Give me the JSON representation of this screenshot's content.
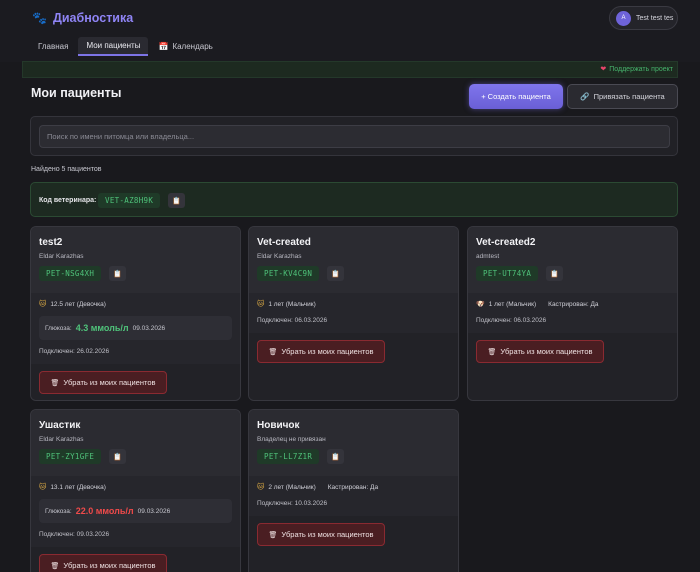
{
  "app": {
    "title": "Диабностика",
    "logo_icon": "paw-icon"
  },
  "user": {
    "avatar_letter": "A",
    "name": "Test test tes"
  },
  "nav": {
    "tabs": [
      {
        "label": "Главная"
      },
      {
        "label": "Мои пациенты"
      },
      {
        "label": "Календарь"
      }
    ]
  },
  "support": {
    "label": "Поддержать проект"
  },
  "page": {
    "title": "Мои пациенты",
    "create_button": "+ Создать пациента",
    "link_button": "Привязать пациента",
    "search_placeholder": "Поиск по имени питомца или владельца...",
    "found_text": "Найдено 5 пациентов"
  },
  "vet": {
    "label": "Код ветеринара:",
    "code": "VET-AZ8H9K"
  },
  "labels": {
    "glucose": "Глюкоза:",
    "remove": "Убрать из моих пациентов",
    "castrated": "Кастрирован: Да"
  },
  "patients": [
    {
      "name": "test2",
      "owner": "Eldar Karazhas",
      "code": "PET-NSG4XH",
      "info": "12.5 лет (Девочка)",
      "icon": "cat-icon",
      "glucose_value": "4.3 ммоль/л",
      "glucose_date": "09.03.2026",
      "glucose_status": "normal",
      "connected": "Подключен: 26.02.2026"
    },
    {
      "name": "Vet-created",
      "owner": "Eldar Karazhas",
      "code": "PET-KV4C9N",
      "info": "1 лет (Мальчик)",
      "icon": "cat-icon",
      "connected": "Подключен: 06.03.2026"
    },
    {
      "name": "Vet-created2",
      "owner": "admtest",
      "code": "PET-UT74YA",
      "info": "1 лет (Мальчик)",
      "castrated": "Кастрирован: Да",
      "icon": "dog-icon",
      "connected": "Подключен: 06.03.2026"
    },
    {
      "name": "Ушастик",
      "owner": "Eldar Karazhas",
      "code": "PET-ZY1GFE",
      "info": "13.1 лет (Девочка)",
      "icon": "cat-icon",
      "glucose_value": "22.0 ммоль/л",
      "glucose_date": "09.03.2026",
      "glucose_status": "high",
      "connected": "Подключен: 09.03.2026"
    },
    {
      "name": "Новичок",
      "owner": "Владелец не привязан",
      "code": "PET-LL7Z1R",
      "info": "2 лет (Мальчик)",
      "castrated": "Кастрирован: Да",
      "icon": "cat-icon",
      "connected": "Подключен: 10.03.2026"
    }
  ],
  "colors": {
    "accent": "#7d74e6",
    "code_green": "#4fc27a",
    "danger": "#ef4a4a",
    "remove_bg": "#4a1e22"
  }
}
